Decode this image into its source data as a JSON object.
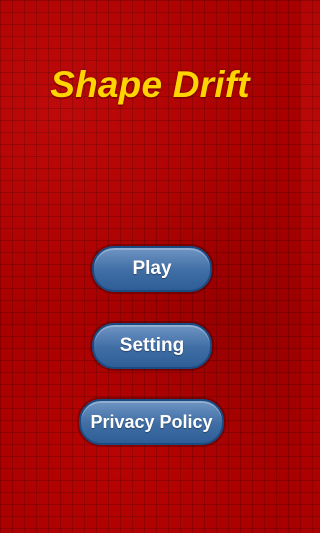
{
  "game": {
    "title": "Shape Drift",
    "title_color": "#ffd400",
    "background_color": "#a80000"
  },
  "menu": {
    "buttons": [
      {
        "label": "Play"
      },
      {
        "label": "Setting"
      },
      {
        "label": "Privacy Policy"
      }
    ],
    "button_color": "#4f7db3"
  }
}
